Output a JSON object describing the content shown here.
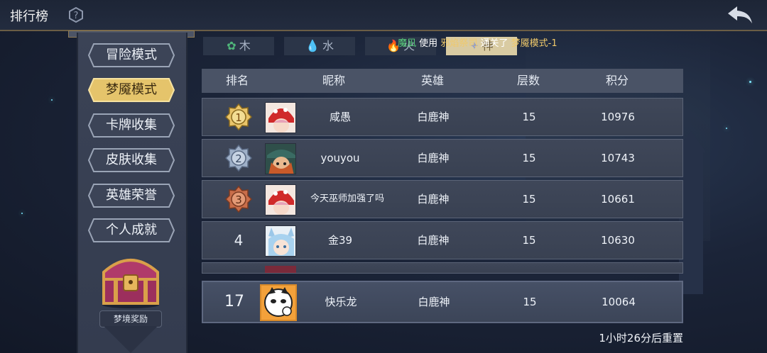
{
  "header": {
    "title": "排行榜"
  },
  "sidebar": {
    "items": [
      {
        "label": "冒险模式",
        "active": false
      },
      {
        "label": "梦魇模式",
        "active": true
      },
      {
        "label": "卡牌收集",
        "active": false
      },
      {
        "label": "皮肤收集",
        "active": false
      },
      {
        "label": "英雄荣誉",
        "active": false
      },
      {
        "label": "个人成就",
        "active": false
      }
    ],
    "reward_label": "梦境奖励"
  },
  "tabs": [
    {
      "label": "木",
      "icon": "leaf-icon"
    },
    {
      "label": "水",
      "icon": "water-drop-icon"
    },
    {
      "label": "火",
      "icon": "fire-icon"
    },
    {
      "label": "神",
      "icon": "divine-icon",
      "active": true
    }
  ],
  "announcement": {
    "player": "魔凪",
    "text1": "使用",
    "hero": "邪焰祭司",
    "text2": "通关了",
    "mode": "梦魇模式-1"
  },
  "table": {
    "headers": {
      "rank": "排名",
      "nickname": "昵称",
      "hero": "英雄",
      "floors": "层数",
      "score": "积分"
    },
    "rows": [
      {
        "rank": "1",
        "nickname": "咸愚",
        "hero": "白鹿神",
        "floors": "15",
        "score": "10976"
      },
      {
        "rank": "2",
        "nickname": "youyou",
        "hero": "白鹿神",
        "floors": "15",
        "score": "10743"
      },
      {
        "rank": "3",
        "nickname": "今天巫师加强了吗",
        "hero": "白鹿神",
        "floors": "15",
        "score": "10661"
      },
      {
        "rank": "4",
        "nickname": "金39",
        "hero": "白鹿神",
        "floors": "15",
        "score": "10630"
      }
    ],
    "my_row": {
      "rank": "17",
      "nickname": "快乐龙",
      "hero": "白鹿神",
      "floors": "15",
      "score": "10064"
    }
  },
  "reset_text": "1小时26分后重置",
  "colors": {
    "gold": "#e9c46a",
    "silver": "#9fb0c8",
    "bronze": "#c96e4a",
    "active_tab": "#d9cba2"
  }
}
